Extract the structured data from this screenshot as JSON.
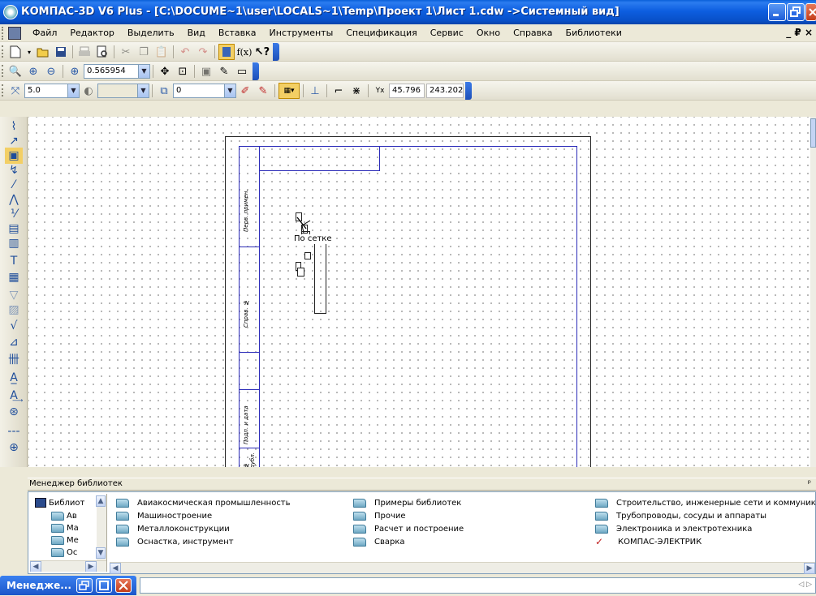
{
  "window": {
    "title": "КОМПАС-3D V6 Plus - [C:\\DOCUME~1\\user\\LOCALS~1\\Temp\\Проект 1\\Лист 1.cdw ->Системный вид]"
  },
  "menu": {
    "items": [
      "Файл",
      "Редактор",
      "Выделить",
      "Вид",
      "Вставка",
      "Инструменты",
      "Спецификация",
      "Сервис",
      "Окно",
      "Справка",
      "Библиотеки"
    ],
    "mdi_controls": "_ ₽ ×"
  },
  "view_toolbar": {
    "zoom_value": "0.565954"
  },
  "current_state": {
    "step_value": "5.0",
    "layer_value": "0",
    "x_coord": "45.796",
    "y_coord": "243.202"
  },
  "canvas": {
    "tooltip": "По сетке",
    "stamp_texts": [
      "Перв. примен.",
      "Справ. №",
      "Подп. и дата",
      "№ дубл."
    ]
  },
  "library_manager": {
    "title": "Менеджер библиотек",
    "pin": "ᵖ",
    "tree": [
      {
        "label": "Библиот",
        "type": "root"
      },
      {
        "label": "Ав",
        "type": "folder"
      },
      {
        "label": "Ма",
        "type": "folder"
      },
      {
        "label": "Ме",
        "type": "folder"
      },
      {
        "label": "Ос",
        "type": "folder"
      }
    ],
    "column1": [
      "Авиакосмическая промышленность",
      "Машиностроение",
      "Металлоконструкции",
      "Оснастка, инструмент"
    ],
    "column2": [
      "Примеры библиотек",
      "Прочие",
      "Расчет и построение",
      "Сварка"
    ],
    "column3": [
      "Строительство, инженерные сети и коммуникации",
      "Трубопроводы, сосуды и аппараты",
      "Электроника и электротехника",
      "КОМПАС-ЭЛЕКТРИК"
    ]
  },
  "taskbar": {
    "minimized_label": "Менедже..."
  },
  "status": {
    "right_arrows": "◁ ▷"
  }
}
